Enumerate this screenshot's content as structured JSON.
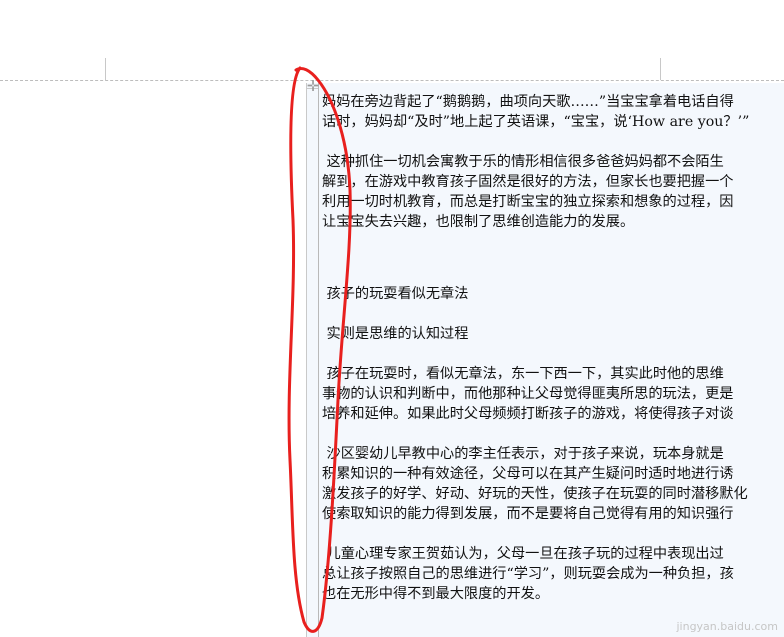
{
  "doc": {
    "lines": [
      "妈妈在旁边背起了“鹅鹅鹅，曲项向天歌……”当宝宝拿着电话自得",
      "话时，妈妈却“及时”地上起了英语课，“宝宝，说‘How are you？’”"
    ],
    "para2": [
      "这种抓住一切机会寓教于乐的情形相信很多爸爸妈妈都不会陌生",
      "解到，在游戏中教育孩子固然是很好的方法，但家长也要把握一个",
      "利用一切时机教育，而总是打断宝宝的独立探索和想象的过程，因",
      "让宝宝失去兴趣，也限制了思维创造能力的发展。"
    ],
    "heading1": "孩子的玩耍看似无章法",
    "heading2": "实则是思维的认知过程",
    "para3": [
      "孩子在玩耍时，看似无章法，东一下西一下，其实此时他的思维",
      "事物的认识和判断中，而他那种让父母觉得匪夷所思的玩法，更是",
      "培养和延伸。如果此时父母频频打断孩子的游戏，将使得孩子对谈"
    ],
    "para4": [
      "沙区婴幼儿早教中心的李主任表示，对于孩子来说，玩本身就是",
      "积累知识的一种有效途径，父母可以在其产生疑问时适时地进行诱",
      "激发孩子的好学、好动、好玩的天性，使孩子在玩耍的同时潜移默化",
      "使索取知识的能力得到发展，而不是要将自己觉得有用的知识强行"
    ],
    "para5": [
      "儿童心理专家王贺茹认为，父母一旦在孩子玩的过程中表现出过",
      "总让孩子按照自己的思维进行“学习”，则玩耍会成为一种负担，孩",
      "也在无形中得不到最大限度的开发。"
    ]
  },
  "handle_glyph": "✛",
  "watermark": "jingyan.baidu.com",
  "colors": {
    "annotation": "#e8201e",
    "cell_bg": "#f4f8fd"
  }
}
